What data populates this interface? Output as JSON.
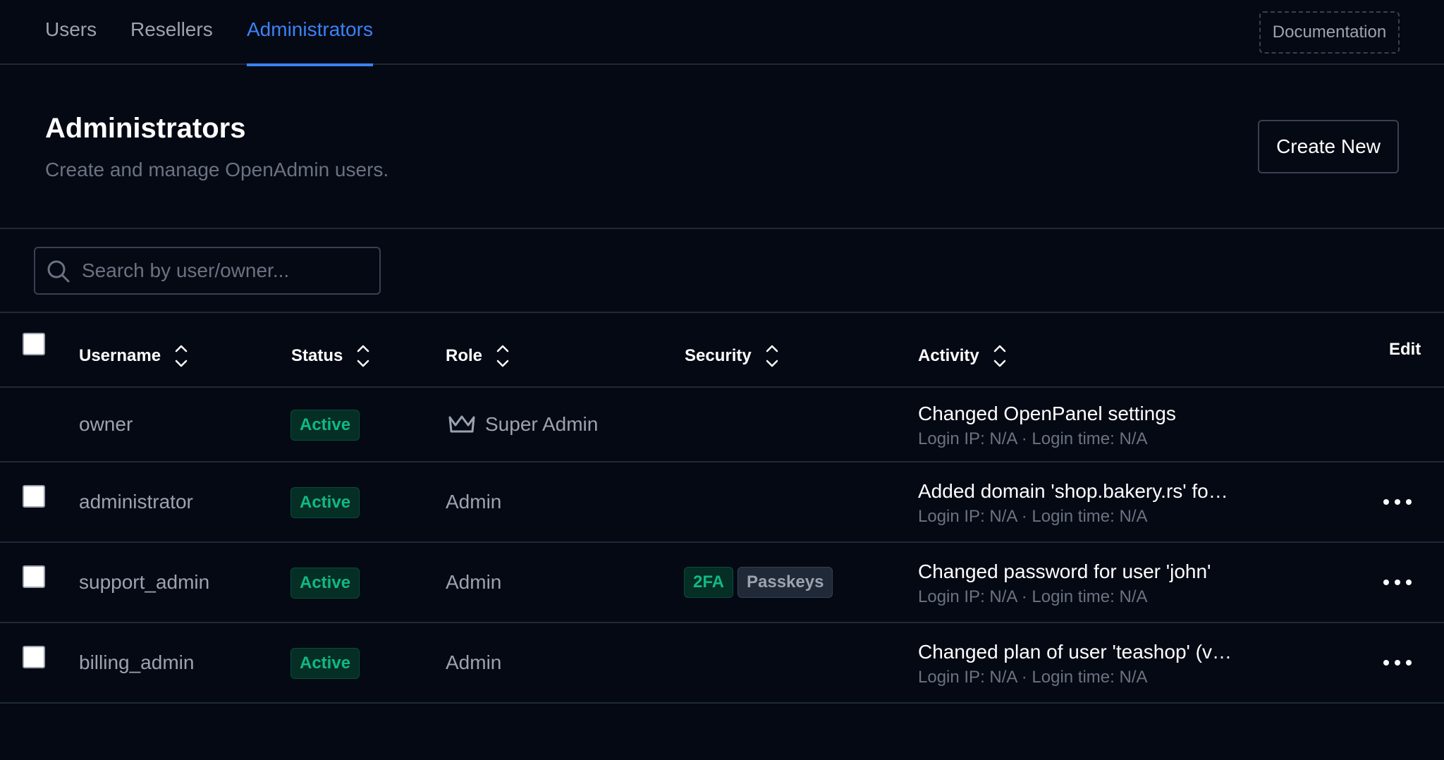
{
  "tabs": [
    {
      "label": "Users",
      "active": false
    },
    {
      "label": "Resellers",
      "active": false
    },
    {
      "label": "Administrators",
      "active": true
    }
  ],
  "documentation_label": "Documentation",
  "header": {
    "title": "Administrators",
    "subtitle": "Create and manage OpenAdmin users.",
    "create_label": "Create New"
  },
  "search": {
    "placeholder": "Search by user/owner...",
    "value": ""
  },
  "table": {
    "columns": [
      "Username",
      "Status",
      "Role",
      "Security",
      "Activity",
      "Edit"
    ],
    "rows": [
      {
        "username": "owner",
        "status": "Active",
        "role": "Super Admin",
        "role_icon": "crown-icon",
        "security": [],
        "activity": "Changed OpenPanel settings",
        "activity_meta": "Login IP: N/A · Login time: N/A",
        "has_checkbox": false,
        "has_edit": false
      },
      {
        "username": "administrator",
        "status": "Active",
        "role": "Admin",
        "security": [],
        "activity": "Added domain 'shop.bakery.rs' fo…",
        "activity_meta": "Login IP: N/A · Login time: N/A",
        "has_checkbox": true,
        "has_edit": true
      },
      {
        "username": "support_admin",
        "status": "Active",
        "role": "Admin",
        "security": [
          "2FA",
          "Passkeys"
        ],
        "activity": "Changed password for user 'john'",
        "activity_meta": "Login IP: N/A · Login time: N/A",
        "has_checkbox": true,
        "has_edit": true
      },
      {
        "username": "billing_admin",
        "status": "Active",
        "role": "Admin",
        "security": [],
        "activity": "Changed plan of user 'teashop' (v…",
        "activity_meta": "Login IP: N/A · Login time: N/A",
        "has_checkbox": true,
        "has_edit": true
      }
    ]
  },
  "colors": {
    "background": "#050914",
    "accent": "#3b82f6",
    "success": "#10b981",
    "border": "#1f2937"
  }
}
